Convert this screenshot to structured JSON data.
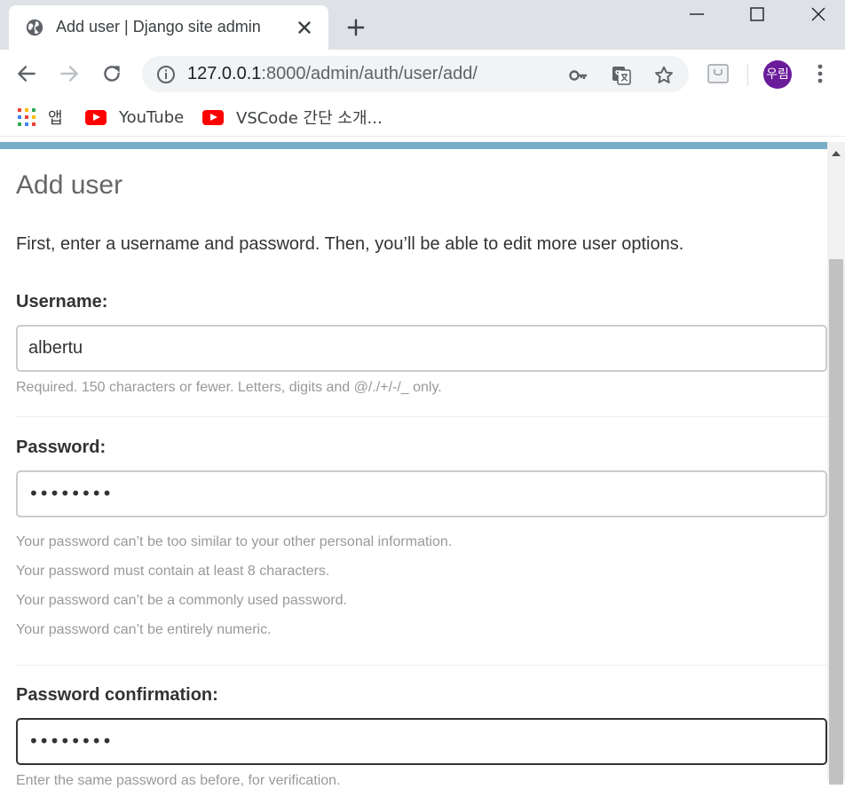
{
  "browser": {
    "tab_title": "Add user | Django site admin",
    "url_host": "127.0.0.1",
    "url_rest": ":8000/admin/auth/user/add/",
    "profile_label": "우림",
    "bookmarks": [
      {
        "label": "앱",
        "icon": "apps-icon"
      },
      {
        "label": "YouTube",
        "icon": "youtube-icon"
      },
      {
        "label": "VSCode 간단 소개...",
        "icon": "youtube-icon"
      }
    ]
  },
  "page": {
    "title": "Add user",
    "intro": "First, enter a username and password. Then, you’ll be able to edit more user options.",
    "username": {
      "label": "Username:",
      "value": "albertu",
      "help": "Required. 150 characters or fewer. Letters, digits and @/./+/-/_ only."
    },
    "password": {
      "label": "Password:",
      "value": "••••••••",
      "help": [
        "Your password can’t be too similar to your other personal information.",
        "Your password must contain at least 8 characters.",
        "Your password can’t be a commonly used password.",
        "Your password can’t be entirely numeric."
      ]
    },
    "password_confirmation": {
      "label": "Password confirmation:",
      "value": "••••••••",
      "help": "Enter the same password as before, for verification."
    }
  },
  "colors": {
    "accent_bar": "#79aec8",
    "avatar_bg": "#6a1b9a",
    "tabbar_bg": "#dee1e6"
  }
}
